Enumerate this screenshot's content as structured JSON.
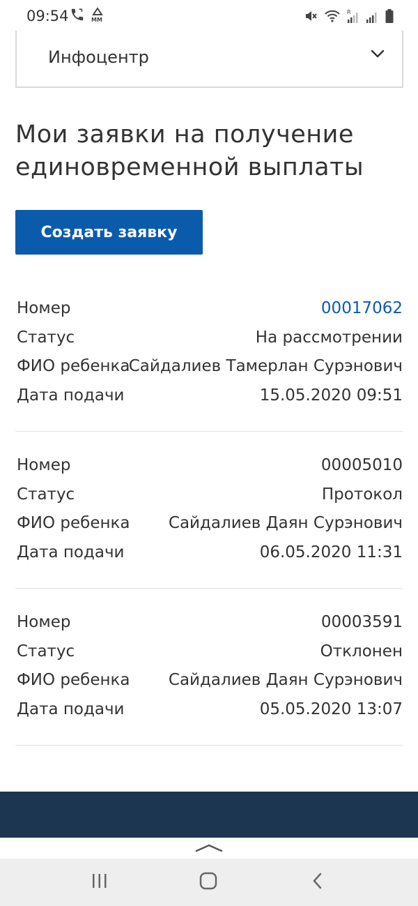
{
  "status_bar": {
    "time": "09:54",
    "left_icons": [
      "call-icon",
      "mm-icon"
    ],
    "right_icons": [
      "mute-icon",
      "wifi-icon",
      "signal-roaming-icon",
      "signal-icon",
      "battery-icon"
    ]
  },
  "accordion": {
    "label": "Инфоцентр",
    "icon": "chevron-down-icon"
  },
  "page": {
    "title": "Мои заявки на получение единовременной выплаты",
    "create_button_label": "Создать заявку"
  },
  "labels": {
    "number": "Номер",
    "status": "Статус",
    "child_name": "ФИО ребенка",
    "date": "Дата подачи"
  },
  "requests": [
    {
      "number": "00017062",
      "status": "На рассмотрении",
      "child_name": "Сайдалиев Тамерлан Сурэнович",
      "date": "15.05.2020 09:51"
    },
    {
      "number": "00005010",
      "status": "Протокол",
      "child_name": "Сайдалиев Даян Сурэнович",
      "date": "06.05.2020 11:31"
    },
    {
      "number": "00003591",
      "status": "Отклонен",
      "child_name": "Сайдалиев Даян Сурэнович",
      "date": "05.05.2020 13:07"
    }
  ],
  "colors": {
    "accent": "#0b5bad",
    "footer": "#1c3550",
    "nav_bar": "#eeeeee",
    "divider": "#e2e2e2"
  },
  "navigation": {
    "icons": [
      "recent-apps-icon",
      "home-icon",
      "back-icon"
    ]
  }
}
